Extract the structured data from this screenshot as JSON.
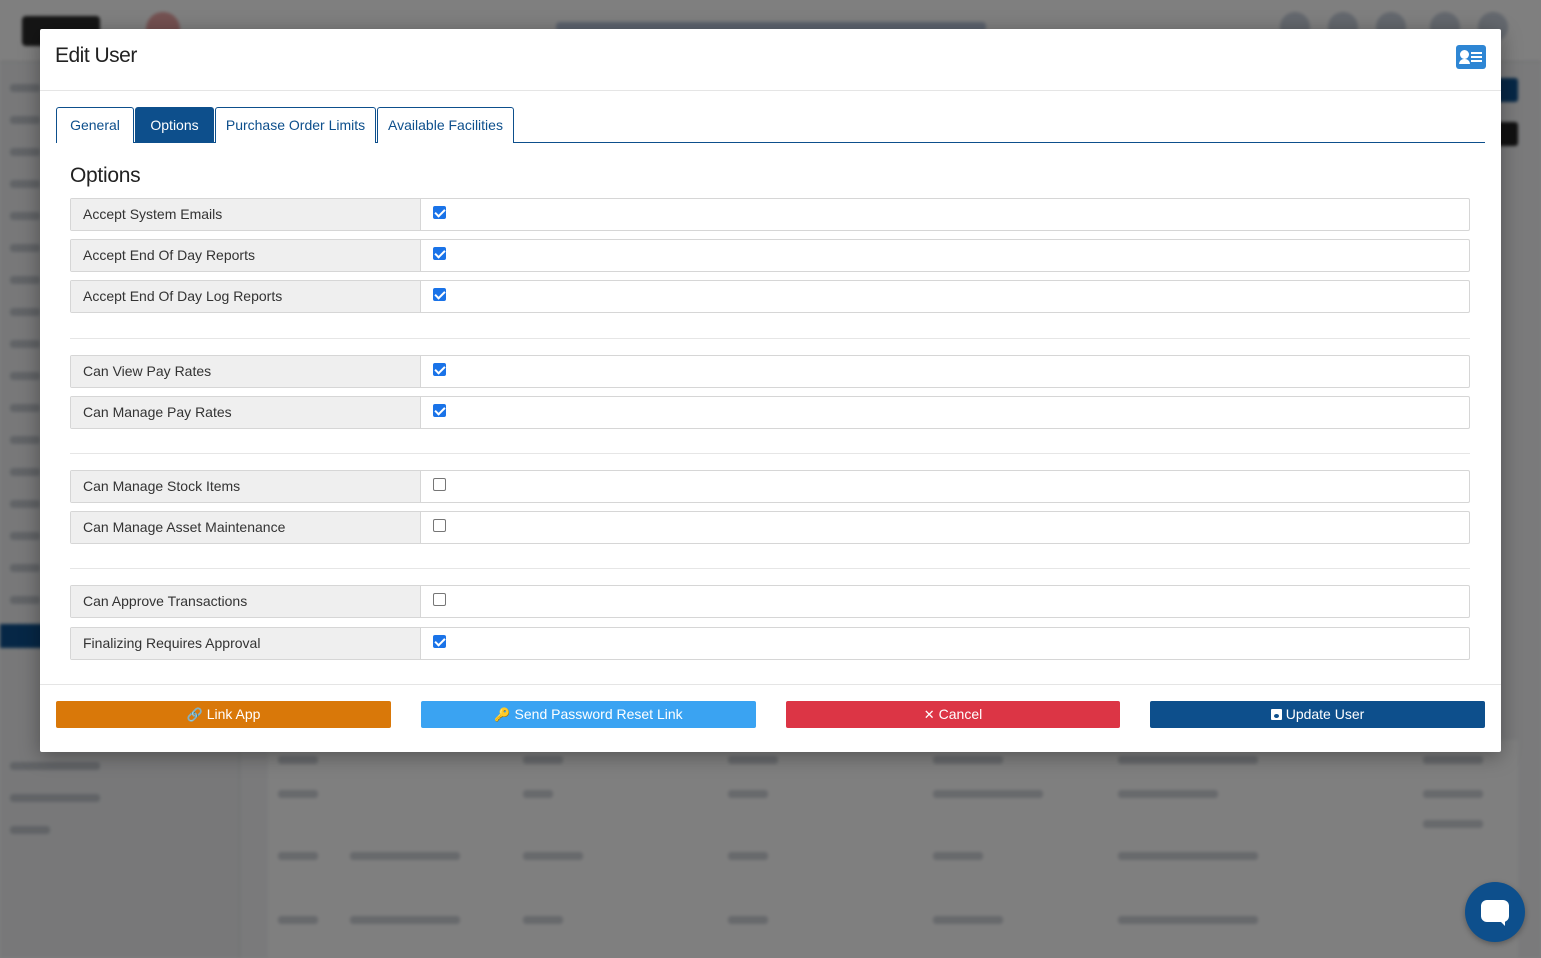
{
  "modal": {
    "title": "Edit User",
    "header_icon": "id-card-icon"
  },
  "tabs": [
    {
      "label": "General",
      "active": false
    },
    {
      "label": "Options",
      "active": true
    },
    {
      "label": "Purchase Order Limits",
      "active": false
    },
    {
      "label": "Available Facilities",
      "active": false
    }
  ],
  "options": {
    "title": "Options",
    "items": [
      {
        "label": "Accept System Emails",
        "checked": true
      },
      {
        "label": "Accept End Of Day Reports",
        "checked": true
      },
      {
        "label": "Accept End Of Day Log Reports",
        "checked": true
      },
      {
        "label": "Can View Pay Rates",
        "checked": true
      },
      {
        "label": "Can Manage Pay Rates",
        "checked": true
      },
      {
        "label": "Can Manage Stock Items",
        "checked": false
      },
      {
        "label": "Can Manage Asset Maintenance",
        "checked": false
      },
      {
        "label": "Can Approve Transactions",
        "checked": false
      },
      {
        "label": "Finalizing Requires Approval",
        "checked": true
      }
    ]
  },
  "footer": {
    "link_app": "Link App",
    "send_reset": "Send Password Reset Link",
    "cancel": "Cancel",
    "update_user": "Update User"
  },
  "colors": {
    "primary": "#0d4f8c",
    "link_app": "#d97809",
    "send_reset": "#3aa3f2",
    "cancel": "#dc3545",
    "checkbox_checked": "#1a73e8"
  }
}
